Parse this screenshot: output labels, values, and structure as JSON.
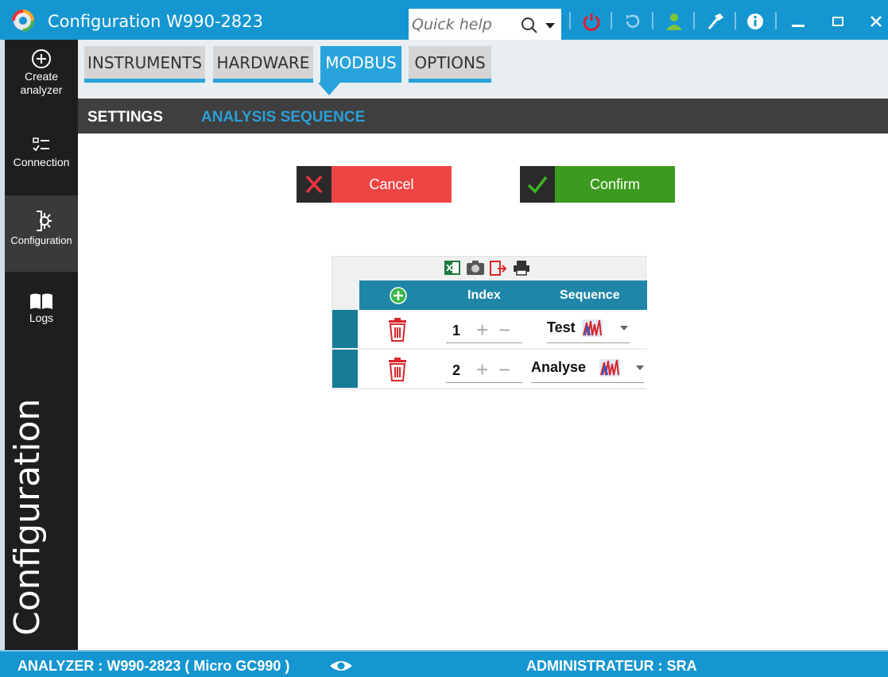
{
  "window": {
    "title": "Configuration W990-2823",
    "quick_help_placeholder": "Quick help"
  },
  "sidebar": {
    "items": [
      {
        "label_line1": "Create",
        "label_line2": "analyzer",
        "icon": "plus-circle-icon"
      },
      {
        "label": "Connection",
        "icon": "checklist-icon"
      },
      {
        "label": "Configuration",
        "icon": "gear-config-icon",
        "active": true
      },
      {
        "label": "Logs",
        "icon": "book-icon"
      }
    ],
    "section_title": "Configuration"
  },
  "tabs": [
    {
      "label": "INSTRUMENTS"
    },
    {
      "label": "HARDWARE"
    },
    {
      "label": "MODBUS",
      "active": true
    },
    {
      "label": "OPTIONS"
    }
  ],
  "subtabs": [
    {
      "label": "SETTINGS"
    },
    {
      "label": "ANALYSIS SEQUENCE",
      "active": true
    }
  ],
  "actions": {
    "cancel_label": "Cancel",
    "confirm_label": "Confirm"
  },
  "table": {
    "toolbar_icons": [
      "excel-icon",
      "camera-icon",
      "export-icon",
      "print-icon"
    ],
    "columns": [
      "Index",
      "Sequence"
    ],
    "rows": [
      {
        "index": "1",
        "sequence": "Test"
      },
      {
        "index": "2",
        "sequence": "Analyse"
      }
    ]
  },
  "status": {
    "analyzer": "ANALYZER :  W990-2823 ( Micro GC990 )",
    "user": "ADMINISTRATEUR :  SRA"
  },
  "colors": {
    "accent": "#1596d1",
    "cancel": "#ef4444",
    "confirm": "#3c9b1e",
    "grid_header": "#1f86a8"
  }
}
